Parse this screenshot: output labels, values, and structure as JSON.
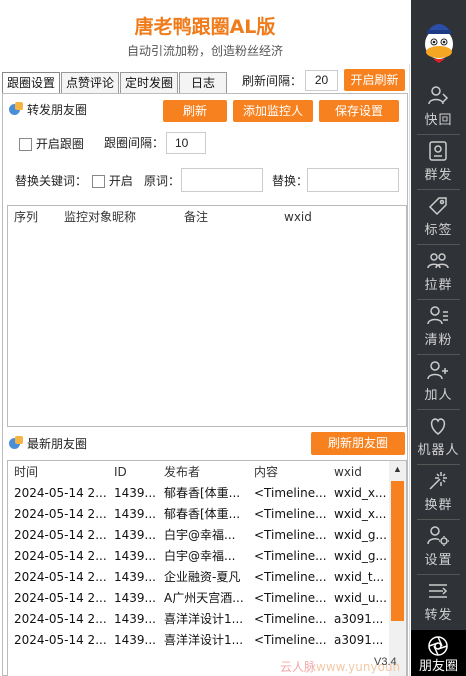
{
  "header": {
    "title": "唐老鸭跟圈AL版",
    "subtitle": "自动引流加粉，创造粉丝经济"
  },
  "tabs": [
    {
      "label": "跟圈设置",
      "active": true
    },
    {
      "label": "点赞评论",
      "active": false
    },
    {
      "label": "定时发圈",
      "active": false
    },
    {
      "label": "日志",
      "active": false
    }
  ],
  "toolbar": {
    "refresh_interval_label": "刷新间隔：",
    "refresh_interval_value": "20",
    "start_refresh_label": "开启刷新"
  },
  "forward": {
    "section_title": "转发朋友圈",
    "refresh_label": "刷新",
    "add_monitor_label": "添加监控人",
    "save_settings_label": "保存设置",
    "enable_follow_label": "开启跟圈",
    "follow_interval_label": "跟圈间隔：",
    "follow_interval_value": "10",
    "replace_keyword_label": "替换关键词：",
    "enable_label": "开启",
    "original_label": "原词：",
    "original_value": "",
    "replace_label": "替换：",
    "replace_value": "",
    "columns": [
      "序列",
      "监控对象昵称",
      "备注",
      "wxid"
    ]
  },
  "latest": {
    "section_title": "最新朋友圈",
    "refresh_label": "刷新朋友圈",
    "columns": [
      "时间",
      "ID",
      "发布者",
      "内容",
      "wxid"
    ],
    "rows": [
      [
        "2024-05-14 2...",
        "1439...",
        "郁春香[体重...",
        "<Timeline...",
        "wxid_x..."
      ],
      [
        "2024-05-14 2...",
        "1439...",
        "郁春香[体重...",
        "<Timeline...",
        "wxid_x..."
      ],
      [
        "2024-05-14 2...",
        "1439...",
        "白宇@幸福...",
        "<Timeline...",
        "wxid_g..."
      ],
      [
        "2024-05-14 2...",
        "1439...",
        "白宇@幸福...",
        "<Timeline...",
        "wxid_g..."
      ],
      [
        "2024-05-14 2...",
        "1439...",
        "企业融资-夏凡",
        "<Timeline...",
        "wxid_t..."
      ],
      [
        "2024-05-14 2...",
        "1439...",
        "A广州天宫酒...",
        "<Timeline...",
        "wxid_u..."
      ],
      [
        "2024-05-14 2...",
        "1439...",
        "喜洋洋设计1...",
        "<Timeline...",
        "a3091..."
      ],
      [
        "2024-05-14 2...",
        "1439...",
        "喜洋洋设计1...",
        "<Timeline...",
        "a3091..."
      ]
    ]
  },
  "sidebar": {
    "items": [
      {
        "label": "快回",
        "icon": "person-reply-icon",
        "active": false
      },
      {
        "label": "群发",
        "icon": "mass-send-icon",
        "active": false
      },
      {
        "label": "标签",
        "icon": "tag-icon",
        "active": false
      },
      {
        "label": "拉群",
        "icon": "group-pull-icon",
        "active": false
      },
      {
        "label": "清粉",
        "icon": "clear-fans-icon",
        "active": false
      },
      {
        "label": "加人",
        "icon": "add-person-icon",
        "active": false
      },
      {
        "label": "机器人",
        "icon": "robot-icon",
        "active": false
      },
      {
        "label": "换群",
        "icon": "switch-group-icon",
        "active": false
      },
      {
        "label": "设置",
        "icon": "person-gear-icon",
        "active": false
      },
      {
        "label": "转发",
        "icon": "forward-icon",
        "active": false
      },
      {
        "label": "朋友圈",
        "icon": "aperture-icon",
        "active": true
      }
    ]
  },
  "footer": {
    "version": "V3.4",
    "watermark_cn": "云人脉",
    "watermark_url": "www.yunyoun"
  },
  "colors": {
    "accent": "#f7811f",
    "title": "#f07b1a",
    "sidebar_bg": "#2f3237"
  }
}
